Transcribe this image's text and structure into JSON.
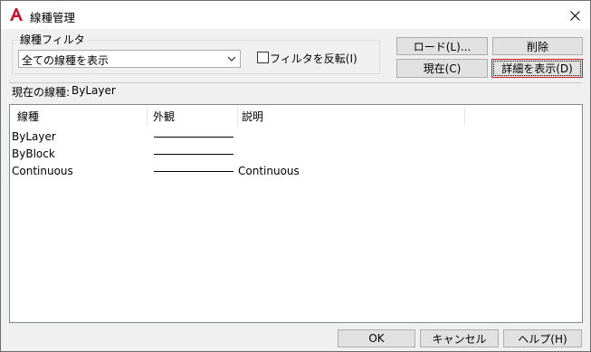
{
  "window": {
    "title": "線種管理",
    "app_icon": "autocad-a-icon",
    "close_icon": "close-icon"
  },
  "filter": {
    "group_label": "線種フィルタ",
    "selected_option": "全ての線種を表示",
    "invert_label": "フィルタを反転(I)",
    "invert_checked": false
  },
  "buttons": {
    "load": "ロード(L)...",
    "delete": "削除",
    "current": "現在(C)",
    "details": "詳細を表示(D)",
    "ok": "OK",
    "cancel": "キャンセル",
    "help": "ヘルプ(H)"
  },
  "current_linetype": {
    "label": "現在の線種:",
    "value": "ByLayer"
  },
  "table": {
    "columns": [
      "線種",
      "外観",
      "説明"
    ],
    "rows": [
      {
        "name": "ByLayer",
        "description": ""
      },
      {
        "name": "ByBlock",
        "description": ""
      },
      {
        "name": "Continuous",
        "description": "Continuous"
      }
    ]
  },
  "colors": {
    "accent_icon": "#c8102e",
    "default_button_border": "#d11a1a"
  }
}
